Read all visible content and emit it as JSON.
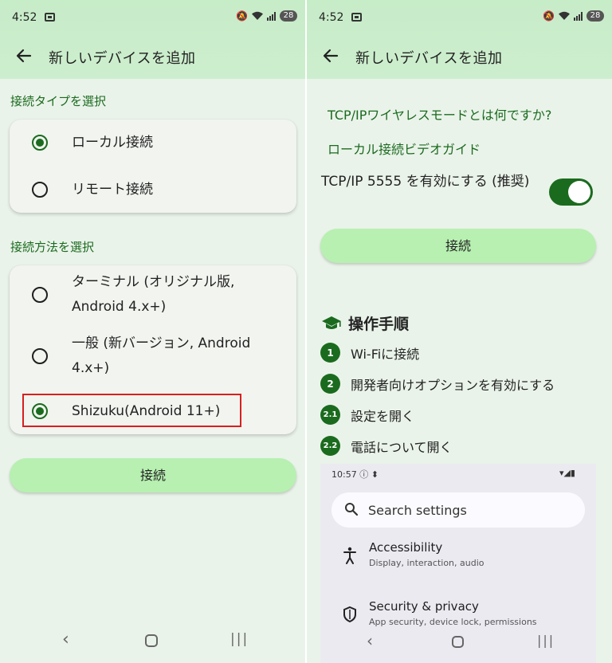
{
  "left": {
    "status": {
      "time": "4:52",
      "battery": "28"
    },
    "appbar": {
      "title": "新しいデバイスを追加"
    },
    "connection_type": {
      "label": "接続タイプを選択",
      "options": [
        {
          "label": "ローカル接続",
          "selected": true
        },
        {
          "label": "リモート接続",
          "selected": false
        }
      ]
    },
    "connection_method": {
      "label": "接続方法を選択",
      "options": [
        {
          "line1": "ターミナル (オリジナル版,",
          "line2": "Android 4.x+)",
          "selected": false
        },
        {
          "line1": "一般 (新バージョン, Android",
          "line2": "4.x+)",
          "selected": false
        },
        {
          "line1": "Shizuku(Android 11+)",
          "line2": "",
          "selected": true
        }
      ]
    },
    "connect_button": "接続"
  },
  "right": {
    "status": {
      "time": "4:52",
      "battery": "28"
    },
    "appbar": {
      "title": "新しいデバイスを追加"
    },
    "links": {
      "what_is_tcpip": "TCP/IPワイヤレスモードとは何ですか?",
      "video_guide": "ローカル接続ビデオガイド"
    },
    "toggle": {
      "label": "TCP/IP 5555 を有効にする (推奨)",
      "on": true
    },
    "connect_button": "接続",
    "steps": {
      "title": "操作手順",
      "items": [
        {
          "badge": "1",
          "text": "Wi-Fiに接続"
        },
        {
          "badge": "2",
          "text": "開発者向けオプションを有効にする"
        },
        {
          "badge": "2.1",
          "text": "設定を開く"
        },
        {
          "badge": "2.2",
          "text": "電話について開く"
        }
      ]
    },
    "embedded_screenshot": {
      "time": "10:57",
      "search_placeholder": "Search settings",
      "items": [
        {
          "title": "Accessibility",
          "subtitle": "Display, interaction, audio",
          "icon": "accessibility-icon"
        },
        {
          "title": "Security & privacy",
          "subtitle": "App security, device lock, permissions",
          "icon": "shield-icon"
        }
      ]
    }
  },
  "colors": {
    "accent": "#1b6b1f",
    "button": "#b7f0b1",
    "highlight": "#d81f1f"
  }
}
